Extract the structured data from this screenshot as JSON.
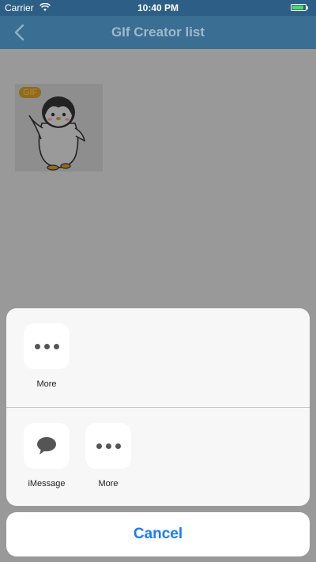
{
  "status_bar": {
    "carrier": "Carrier",
    "time": "10:40 PM",
    "battery_level": 0.85,
    "battery_color": "#4cd964"
  },
  "nav": {
    "title": "GIf Creator list",
    "back_icon": "chevron-left-icon",
    "bar_color": "#3a6f93"
  },
  "grid": {
    "items": [
      {
        "badge": "GIF",
        "image": "penguin-sticker"
      }
    ]
  },
  "share_sheet": {
    "row1": [
      {
        "label": "More",
        "icon": "more-dots-icon"
      }
    ],
    "row2": [
      {
        "label": "iMessage",
        "icon": "speech-bubble-icon"
      },
      {
        "label": "More",
        "icon": "more-dots-icon"
      }
    ],
    "cancel_label": "Cancel",
    "accent": "#1a7cf5"
  }
}
